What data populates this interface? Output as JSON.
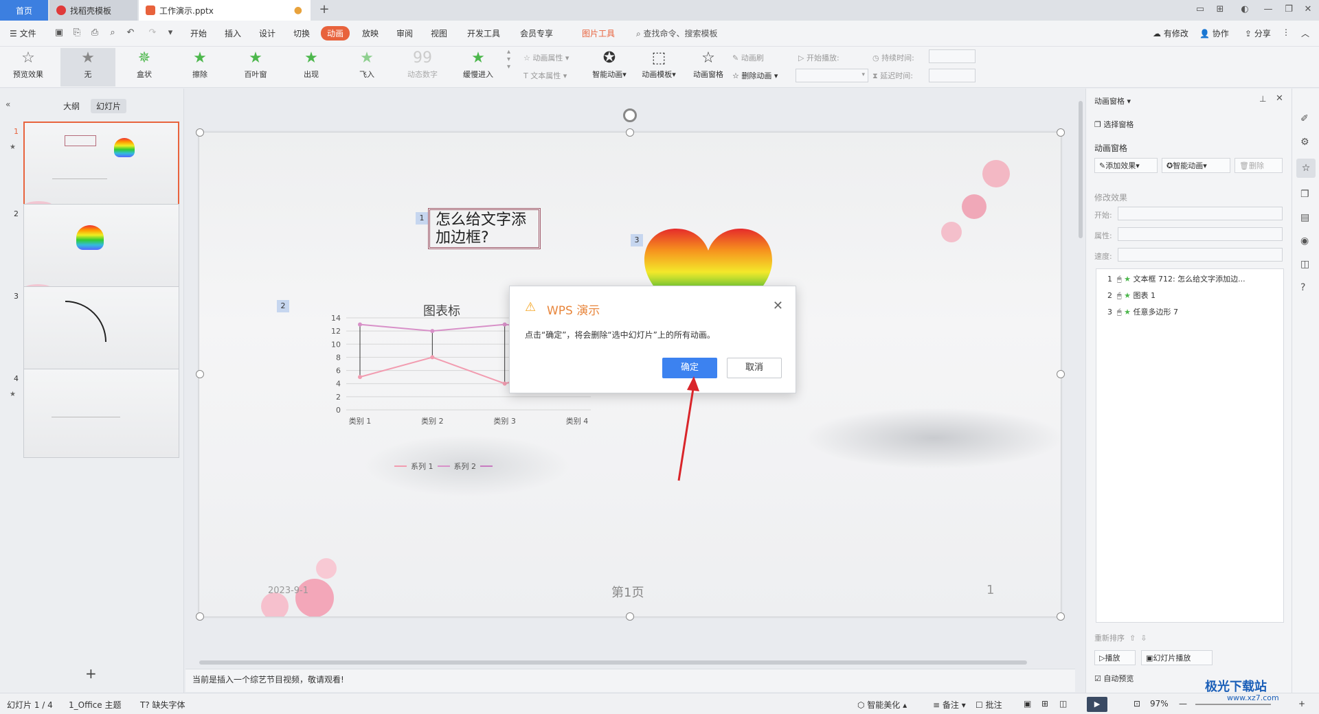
{
  "tabs": {
    "home": "首页",
    "template": "找稻壳模板",
    "doc": "工作演示.pptx"
  },
  "menu": {
    "file": "文件",
    "items": [
      "开始",
      "插入",
      "设计",
      "切换",
      "动画",
      "放映",
      "审阅",
      "视图",
      "开发工具",
      "会员专享",
      "图片工具"
    ],
    "search": "查找命令、搜索模板",
    "modified": "有修改",
    "collab": "协作",
    "share": "分享"
  },
  "ribbon": {
    "preview": "预览效果",
    "effects": [
      "无",
      "盒状",
      "擦除",
      "百叶窗",
      "出现",
      "飞入",
      "动态数字",
      "缓慢进入"
    ],
    "anim_attr": "动画属性",
    "text_attr": "文本属性",
    "smart_anim": "智能动画",
    "anim_template": "动画模板",
    "anim_pane": "动画窗格",
    "anim_brush": "动画刷",
    "delete_anim": "删除动画",
    "start_play": "开始播放:",
    "duration": "持续时间:",
    "delay": "延迟时间:"
  },
  "left_panel": {
    "outline_tab": "大纲",
    "slides_tab": "幻灯片",
    "slide_numbers": [
      "1",
      "2",
      "3",
      "4"
    ]
  },
  "slide": {
    "title_text": "怎么给文字添加边框?",
    "chart_title": "图表标",
    "anim_badges": [
      "1",
      "2",
      "3"
    ],
    "date": "2023-9-1",
    "page_label": "第1页",
    "page_num": "1"
  },
  "chart_data": {
    "type": "line",
    "categories": [
      "类别 1",
      "类别 2",
      "类别 3",
      "类别 4"
    ],
    "series": [
      {
        "name": "系列 1",
        "values": [
          5,
          8,
          4,
          7
        ]
      },
      {
        "name": "系列 2",
        "values": [
          13,
          12,
          13,
          12
        ]
      }
    ],
    "ylim": [
      0,
      14
    ],
    "y_ticks": [
      "0",
      "2",
      "4",
      "6",
      "8",
      "10",
      "12",
      "14"
    ],
    "colors": {
      "s1": "#f29cb0",
      "s2": "#d890c8"
    }
  },
  "dialog": {
    "title": "WPS 演示",
    "message": "点击“确定”，将会删除“选中幻灯片”上的所有动画。",
    "ok": "确定",
    "cancel": "取消"
  },
  "right_panel": {
    "header": "动画窗格",
    "select_pane": "选择窗格",
    "section": "动画窗格",
    "add_effect": "添加效果",
    "smart_anim": "智能动画",
    "delete": "删除",
    "modify_effect": "修改效果",
    "start_label": "开始:",
    "attr_label": "属性:",
    "speed_label": "速度:",
    "list": [
      {
        "num": "1",
        "text": "文本框 712: 怎么给文字添加边..."
      },
      {
        "num": "2",
        "text": "图表 1"
      },
      {
        "num": "3",
        "text": "任意多边形 7"
      }
    ],
    "reorder": "重新排序",
    "play": "播放",
    "slideshow": "幻灯片播放",
    "auto_preview": "自动预览"
  },
  "notes": "当前是插入一个综艺节目视频，敬请观看!",
  "status": {
    "slide_info": "幻灯片 1 / 4",
    "theme": "1_Office 主题",
    "missing_font": "缺失字体",
    "beautify": "智能美化",
    "notes_btn": "备注",
    "comment_btn": "批注",
    "zoom": "97%"
  },
  "watermark": "极光下载站",
  "watermark_url": "www.xz7.com",
  "accent": "#e8623c",
  "primary_button": "#3c82f0"
}
